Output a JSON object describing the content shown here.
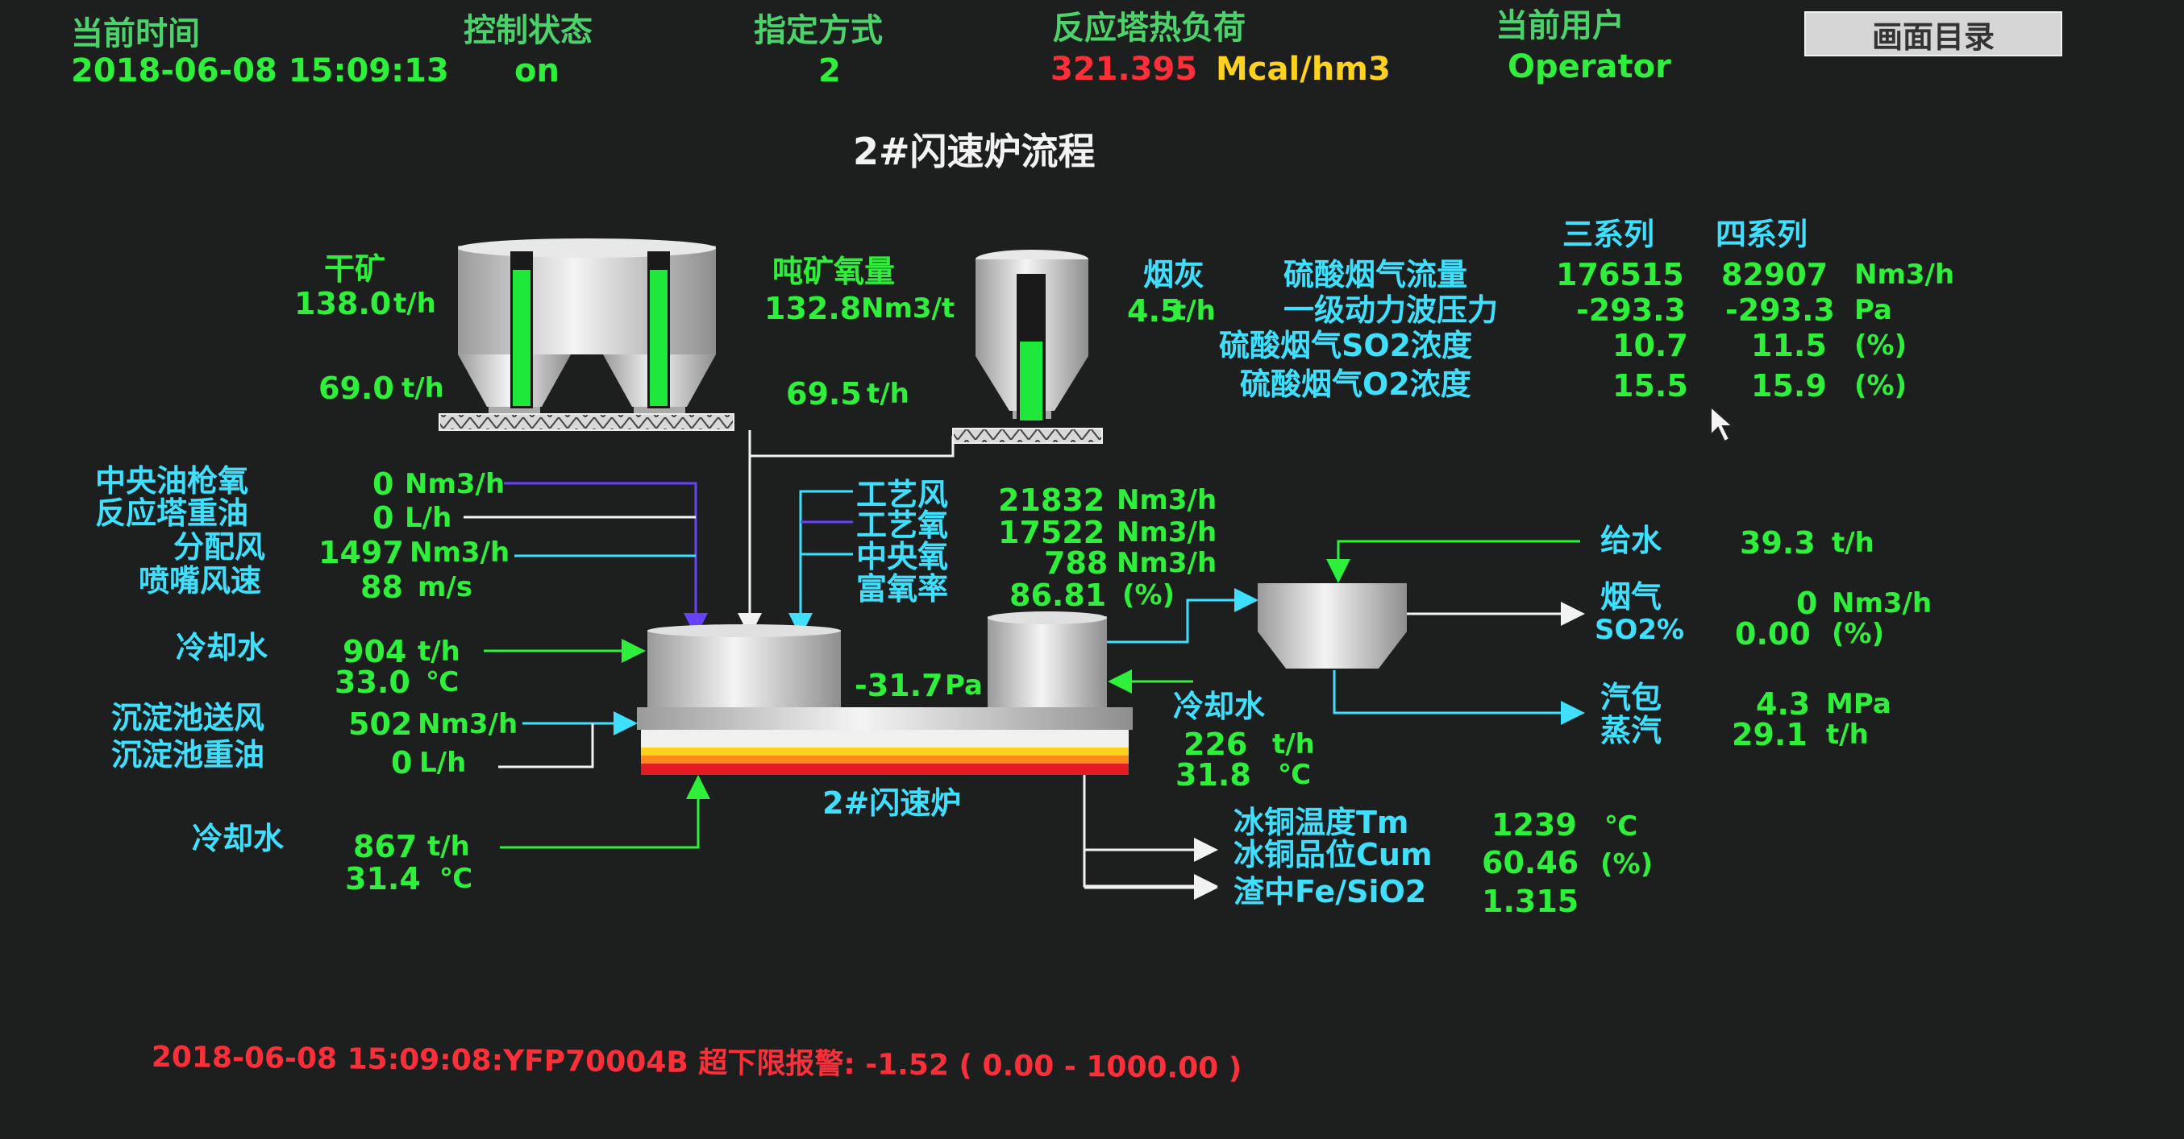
{
  "header": {
    "time_label": "当前时间",
    "time_value": "2018-06-08 15:09:13",
    "control_label": "控制状态",
    "control_value": "on",
    "mode_label": "指定方式",
    "mode_value": "2",
    "heat_label": "反应塔热负荷",
    "heat_value": "321.395",
    "heat_unit": "Mcal/hm3",
    "user_label": "当前用户",
    "user_value": "Operator",
    "menu_button": "画面目录"
  },
  "title": "2#闪速炉流程",
  "feed": {
    "dry_ore_label": "干矿",
    "dry_ore_value": "138.0",
    "dry_ore_unit": "t/h",
    "left_bin_flow": "69.0",
    "left_bin_unit": "t/h",
    "oxygen_per_ton_label": "吨矿氧量",
    "oxygen_per_ton_value": "132.8",
    "oxygen_per_ton_unit": "Nm3/t",
    "right_bin_flow": "69.5",
    "right_bin_unit": "t/h",
    "dust_label": "烟灰",
    "dust_value": "4.5",
    "dust_unit": "t/h"
  },
  "acid_plant": {
    "series3_header": "三系列",
    "series4_header": "四系列",
    "rows": [
      {
        "label": "硫酸烟气流量",
        "s3": "176515",
        "s4": "82907",
        "unit": "Nm3/h"
      },
      {
        "label": "一级动力波压力",
        "s3": "-293.3",
        "s4": "-293.3",
        "unit": "Pa"
      },
      {
        "label": "硫酸烟气SO2浓度",
        "s3": "10.7",
        "s4": "11.5",
        "unit": "(%)"
      },
      {
        "label": "硫酸烟气O2浓度",
        "s3": "15.5",
        "s4": "15.9",
        "unit": "(%)"
      }
    ]
  },
  "left_inputs": {
    "rows": [
      {
        "label": "中央油枪氧",
        "value": "0",
        "unit": "Nm3/h"
      },
      {
        "label": "反应塔重油",
        "value": "0",
        "unit": "L/h"
      },
      {
        "label": "分配风",
        "value": "1497",
        "unit": "Nm3/h"
      },
      {
        "label": "喷嘴风速",
        "value": "88",
        "unit": "m/s"
      }
    ],
    "cooling1_label": "冷却水",
    "cooling1_flow": "904",
    "cooling1_flow_unit": "t/h",
    "cooling1_temp": "33.0",
    "cooling1_temp_unit": "℃",
    "settler_air_label": "沉淀池送风",
    "settler_air_value": "502",
    "settler_air_unit": "Nm3/h",
    "settler_oil_label": "沉淀池重油",
    "settler_oil_value": "0",
    "settler_oil_unit": "L/h",
    "cooling2_label": "冷却水",
    "cooling2_flow": "867",
    "cooling2_flow_unit": "t/h",
    "cooling2_temp": "31.4",
    "cooling2_temp_unit": "℃"
  },
  "process_air": {
    "rows": [
      {
        "label": "工艺风",
        "value": "21832",
        "unit": "Nm3/h"
      },
      {
        "label": "工艺氧",
        "value": "17522",
        "unit": "Nm3/h"
      },
      {
        "label": "中央氧",
        "value": "788",
        "unit": "Nm3/h"
      },
      {
        "label": "富氧率",
        "value": "86.81",
        "unit": "(%)"
      }
    ]
  },
  "furnace": {
    "name": "2#闪速炉",
    "pressure_value": "-31.7",
    "pressure_unit": "Pa",
    "cooling_label": "冷却水",
    "cooling_flow": "226",
    "cooling_flow_unit": "t/h",
    "cooling_temp": "31.8",
    "cooling_temp_unit": "℃",
    "matte_temp_label": "冰铜温度Tm",
    "matte_temp_value": "1239",
    "matte_temp_unit": "℃",
    "matte_grade_label": "冰铜品位Cum",
    "matte_grade_value": "60.46",
    "matte_grade_unit": "(%)",
    "slag_ratio_label": "渣中Fe/SiO2",
    "slag_ratio_value": "1.315"
  },
  "boiler": {
    "feed_water_label": "给水",
    "feed_water_value": "39.3",
    "feed_water_unit": "t/h",
    "flue_label": "烟气",
    "flue_value": "0",
    "flue_unit": "Nm3/h",
    "so2_label": "SO2%",
    "so2_value": "0.00",
    "so2_unit": "(%)",
    "drum_label": "汽包",
    "drum_value": "4.3",
    "drum_unit": "MPa",
    "steam_label": "蒸汽",
    "steam_value": "29.1",
    "steam_unit": "t/h"
  },
  "alarm": {
    "text": "2018-06-08 15:09:08:YFP70004B 超下限报警: -1.52 ( 0.00 - 1000.00 )"
  },
  "colors": {
    "background": "#1d1f1f",
    "label": "#3fe0ff",
    "value": "#2ef03a",
    "alarm": "#ff2f3a",
    "unit_yellow": "#ffd21e",
    "pipe_white": "#f2f2f2",
    "pipe_blue": "#6a40ff",
    "bin_level": "#1ee83a"
  },
  "levels": {
    "left_bin_a": 0.93,
    "left_bin_b": 0.93,
    "dust_bin": 0.55
  }
}
